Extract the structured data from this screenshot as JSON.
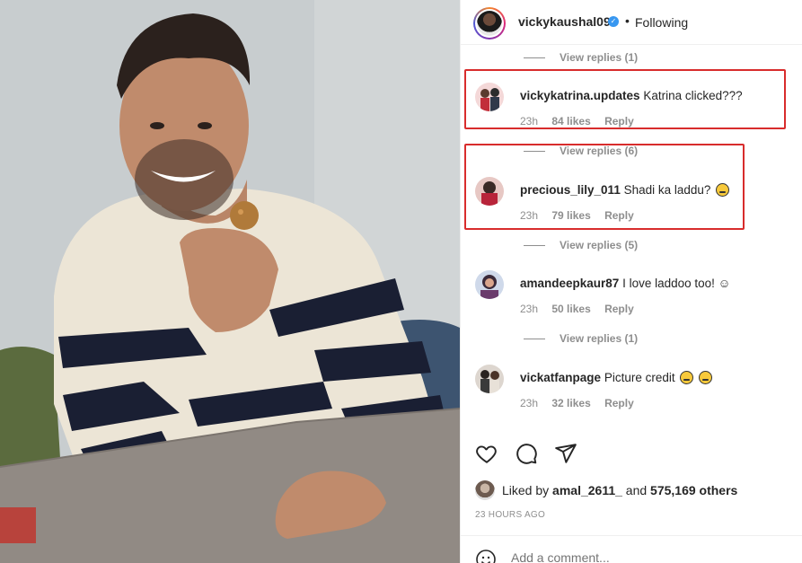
{
  "header": {
    "username": "vickykaushal09",
    "separator": "•",
    "follow_status": "Following"
  },
  "comments": [
    {
      "type": "replies",
      "label": "View replies (1)"
    },
    {
      "type": "comment",
      "username": "vickykatrina.updates",
      "text": "Katrina clicked???",
      "time": "23h",
      "likes": "84 likes",
      "reply": "Reply",
      "highlighted": true
    },
    {
      "type": "replies",
      "label": "View replies (6)"
    },
    {
      "type": "comment",
      "username": "precious_lily_011",
      "text": "Shadi ka laddu?",
      "time": "23h",
      "likes": "79 likes",
      "reply": "Reply",
      "highlighted": true
    },
    {
      "type": "replies",
      "label": "View replies (5)"
    },
    {
      "type": "comment",
      "username": "amandeepkaur87",
      "text": "I love laddoo too! ☺",
      "time": "23h",
      "likes": "50 likes",
      "reply": "Reply"
    },
    {
      "type": "replies",
      "label": "View replies (1)"
    },
    {
      "type": "comment",
      "username": "vickatfanpage",
      "text": "Picture credit",
      "time": "23h",
      "likes": "32 likes",
      "reply": "Reply"
    }
  ],
  "likes": {
    "prefix": "Liked by",
    "first_user": "amal_2611_",
    "conjunction": "and",
    "others": "575,169 others"
  },
  "post_time": "23 HOURS AGO",
  "add_comment": {
    "placeholder": "Add a comment..."
  },
  "colors": {
    "highlight": "#d82c2c",
    "verified": "#3897f0",
    "muted": "#8e8e8e"
  }
}
